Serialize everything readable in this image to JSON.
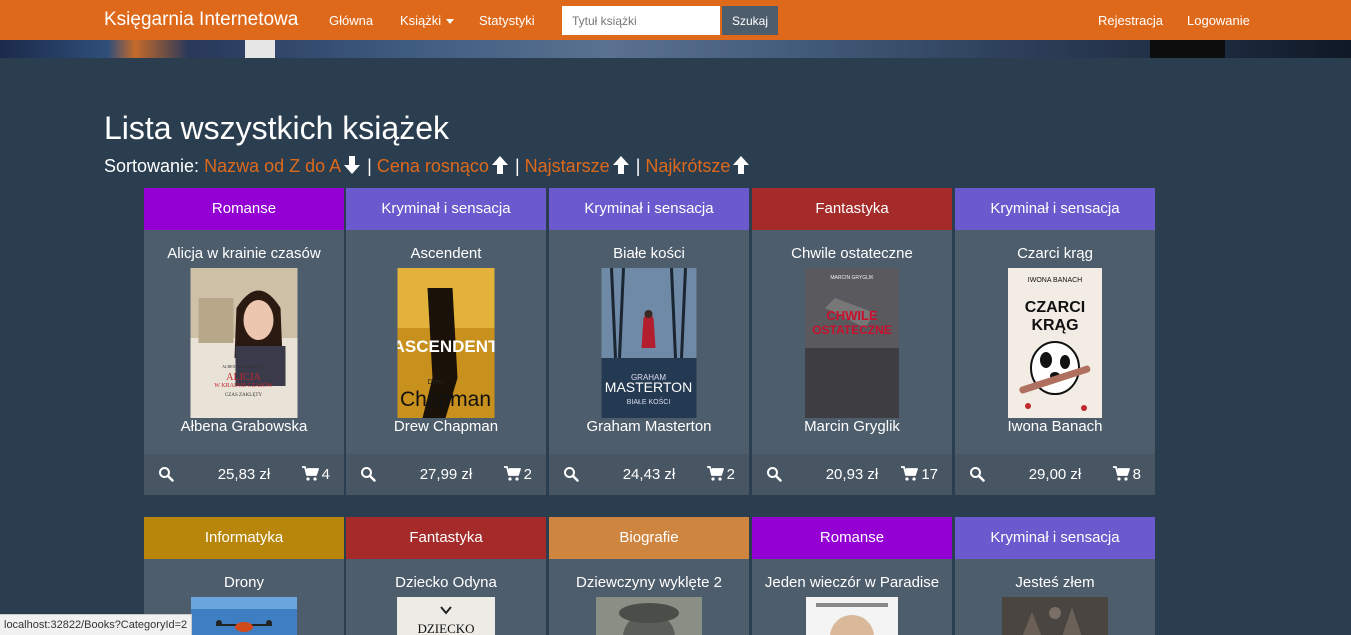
{
  "navbar": {
    "brand": "Księgarnia Internetowa",
    "links": {
      "home": "Główna",
      "books": "Książki",
      "stats": "Statystyki"
    },
    "search": {
      "placeholder": "Tytuł książki",
      "button": "Szukaj"
    },
    "right": {
      "register": "Rejestracja",
      "login": "Logowanie"
    }
  },
  "page": {
    "title": "Lista wszystkich książek",
    "sort": {
      "label": "Sortowanie:",
      "name": "Nazwa od Z do A",
      "price": "Cena rosnąco",
      "age": "Najstarsze",
      "length": "Najkrótsze",
      "separator": "|"
    }
  },
  "books": [
    {
      "category": "Romanse",
      "category_color": "#9400d3",
      "title": "Alicja w krainie czasów",
      "author": "Ałbena Grabowska",
      "price": "25,83 zł",
      "stock": "4"
    },
    {
      "category": "Kryminał i sensacja",
      "category_color": "#6a5acd",
      "title": "Ascendent",
      "author": "Drew Chapman",
      "price": "27,99 zł",
      "stock": "2"
    },
    {
      "category": "Kryminał i sensacja",
      "category_color": "#6a5acd",
      "title": "Białe kości",
      "author": "Graham Masterton",
      "price": "24,43 zł",
      "stock": "2"
    },
    {
      "category": "Fantastyka",
      "category_color": "#a52a2a",
      "title": "Chwile ostateczne",
      "author": "Marcin Gryglik",
      "price": "20,93 zł",
      "stock": "17"
    },
    {
      "category": "Kryminał i sensacja",
      "category_color": "#6a5acd",
      "title": "Czarci krąg",
      "author": "Iwona Banach",
      "price": "29,00 zł",
      "stock": "8"
    },
    {
      "category": "Informatyka",
      "category_color": "#b8860b",
      "title": "Drony"
    },
    {
      "category": "Fantastyka",
      "category_color": "#a52a2a",
      "title": "Dziecko Odyna"
    },
    {
      "category": "Biografie",
      "category_color": "#cd853f",
      "title": "Dziewczyny wyklęte 2"
    },
    {
      "category": "Romanse",
      "category_color": "#9400d3",
      "title": "Jeden wieczór w Paradise"
    },
    {
      "category": "Kryminał i sensacja",
      "category_color": "#6a5acd",
      "title": "Jesteś złem"
    }
  ],
  "covers": {
    "alicja": {
      "line1": "ALBENA GRABOWSKA",
      "line2": "ALICJA",
      "line3": "W KRAINIE CZASÓW",
      "line4": "CZAS ZAKLĘTY"
    },
    "ascendent": {
      "line1": "ASCENDENT",
      "line2": "Drew",
      "line3": "Chapman"
    },
    "biale": {
      "line1": "GRAHAM",
      "line2": "MASTERTON",
      "line3": "BIAŁE KOŚCI"
    },
    "chwile": {
      "line1": "MARCIN GRYGLIK",
      "line2": "CHWILE",
      "line3": "OSTATECZNE"
    },
    "czarci": {
      "line1": "IWONA BANACH",
      "line2": "CZARCI",
      "line3": "KRĄG"
    },
    "dziecko": {
      "line1": "DZIECKO"
    }
  },
  "status_bar": {
    "url": "localhost:32822/Books?CategoryId=2"
  },
  "icons": {
    "search": "search-icon",
    "cart": "cart-icon",
    "sort_down": "arrow-down-icon",
    "sort_up": "arrow-up-icon"
  }
}
